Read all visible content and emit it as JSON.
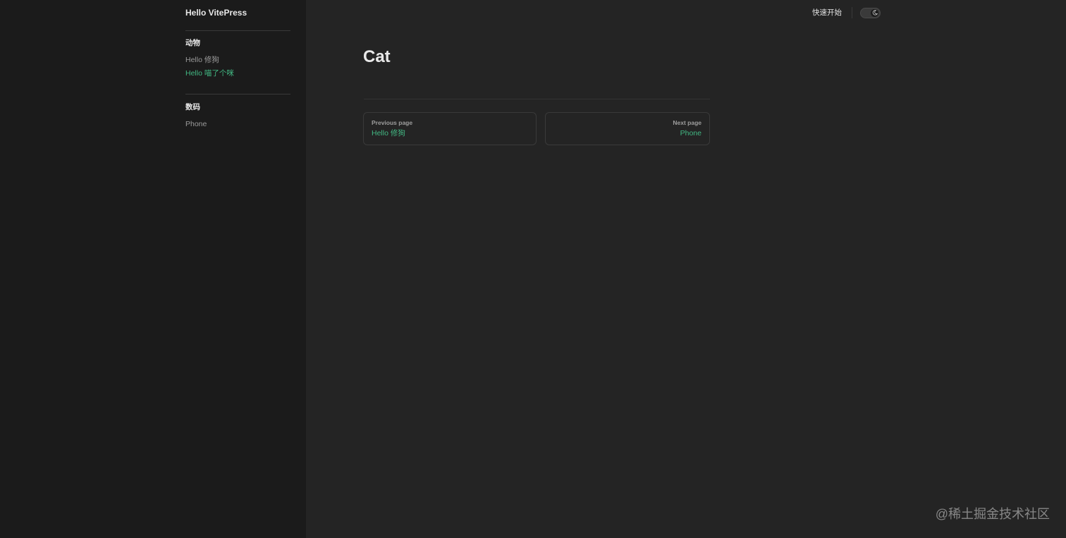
{
  "site": {
    "title": "Hello VitePress"
  },
  "sidebar": {
    "groups": [
      {
        "heading": "动物",
        "items": [
          {
            "label": "Hello 修狗",
            "active": false
          },
          {
            "label": "Hello 喵了个咪",
            "active": true
          }
        ]
      },
      {
        "heading": "数码",
        "items": [
          {
            "label": "Phone",
            "active": false
          }
        ]
      }
    ]
  },
  "nav": {
    "link_label": "快速开始",
    "appearance_icon": "moon-icon"
  },
  "main": {
    "title": "Cat"
  },
  "pager": {
    "prev": {
      "desc": "Previous page",
      "title": "Hello 修狗"
    },
    "next": {
      "desc": "Next page",
      "title": "Phone"
    }
  },
  "watermark": "@稀土掘金技术社区",
  "colors": {
    "brand": "#42b883",
    "background": "#242424",
    "sidebar_background": "#1b1b1b"
  }
}
